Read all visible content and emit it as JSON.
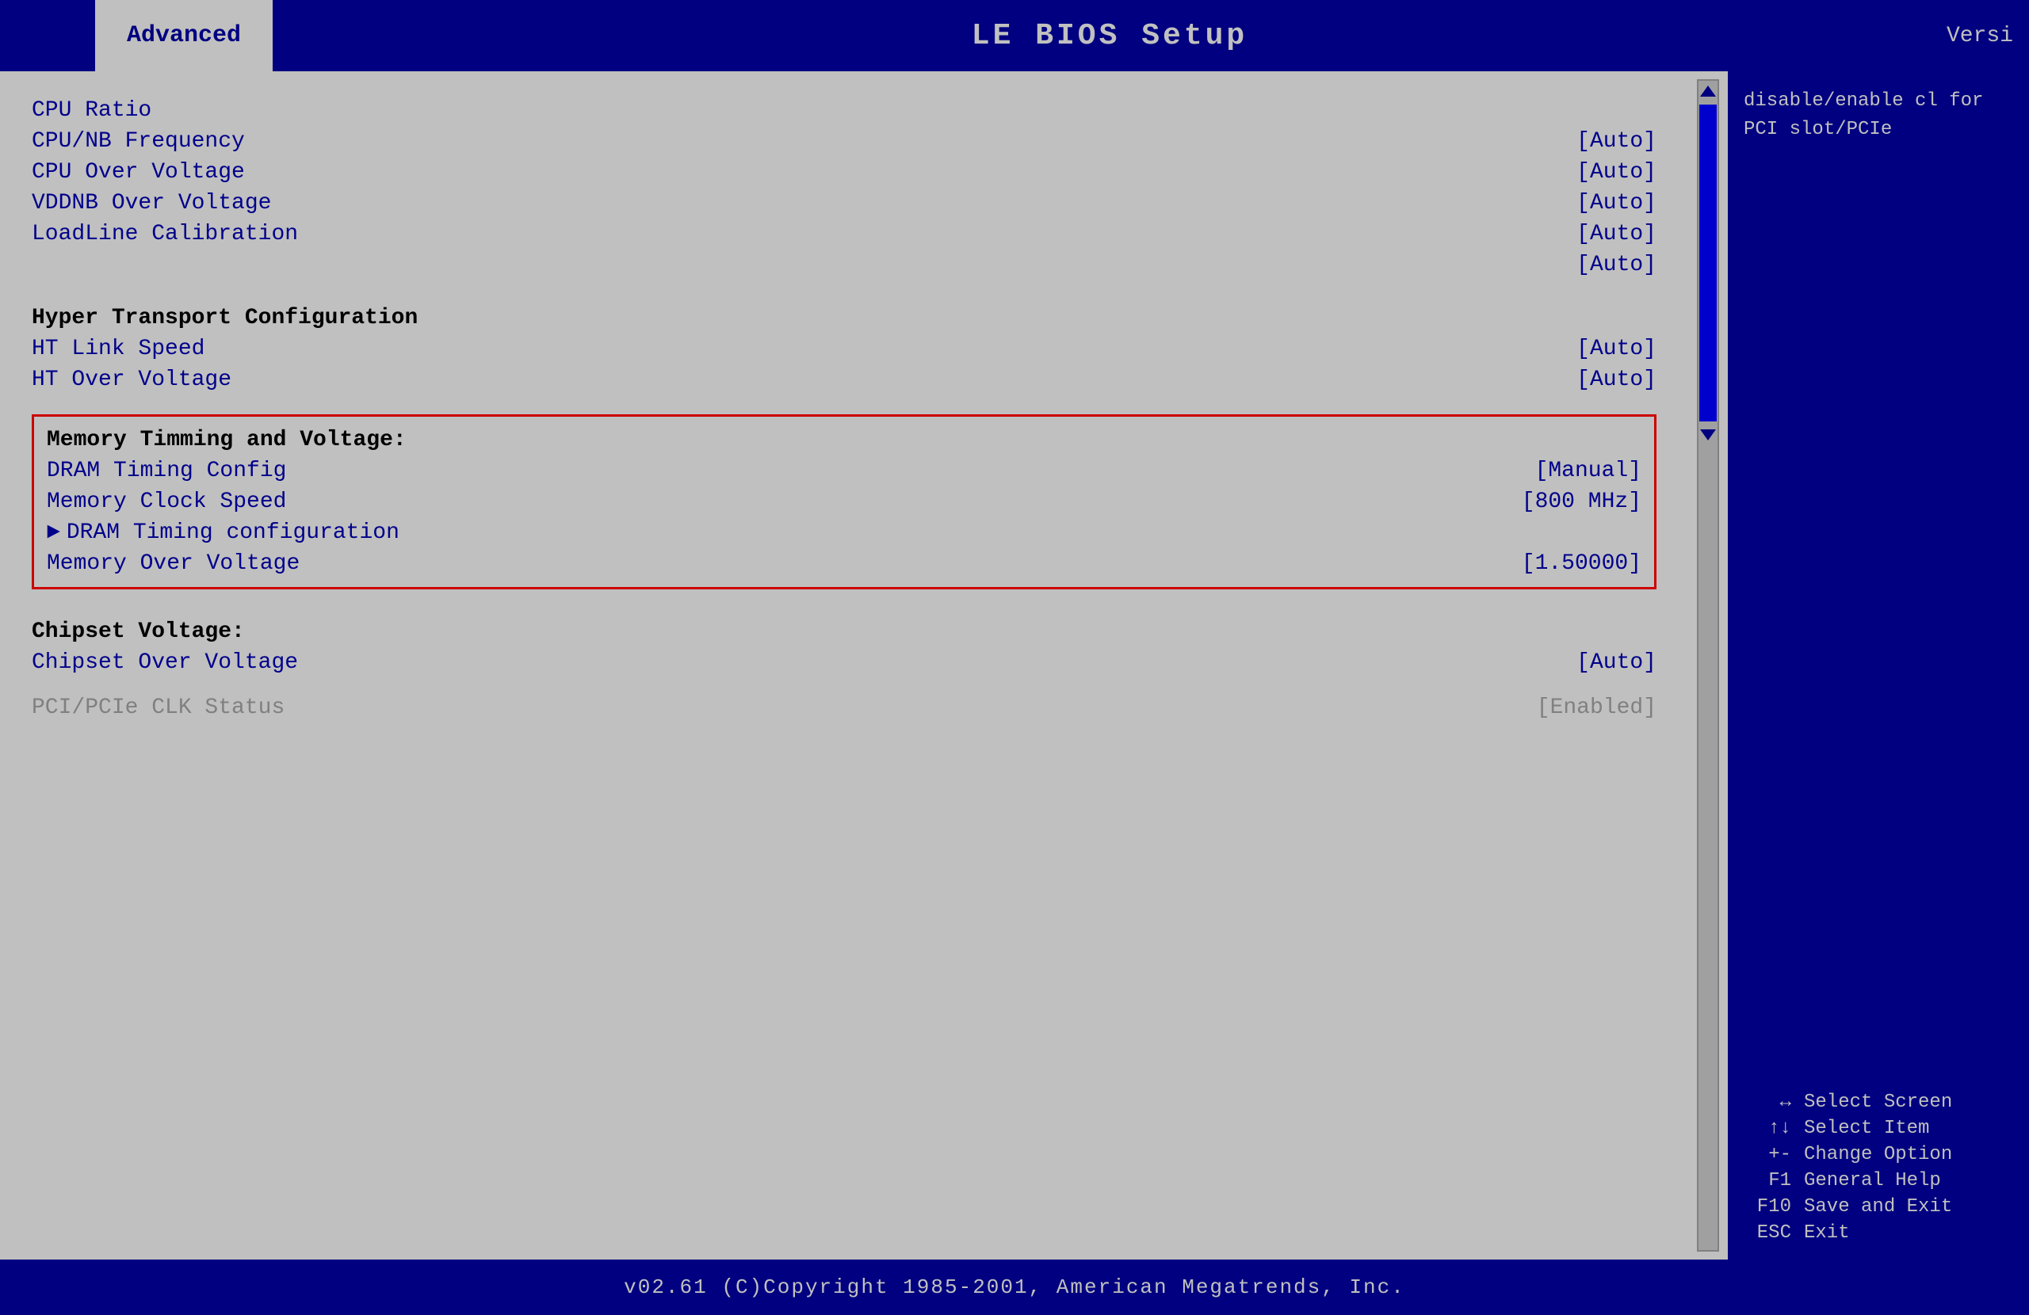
{
  "header": {
    "tab_label": "Advanced",
    "title": "LE BIOS Setup",
    "version_label": "Versi"
  },
  "menu_items": [
    {
      "label": "CPU Ratio",
      "value": "",
      "type": "item"
    },
    {
      "label": "CPU/NB Frequency",
      "value": "[Auto]",
      "type": "item"
    },
    {
      "label": "CPU Over Voltage",
      "value": "[Auto]",
      "type": "item"
    },
    {
      "label": "VDDNB Over Voltage",
      "value": "[Auto]",
      "type": "item"
    },
    {
      "label": "LoadLine Calibration",
      "value": "[Auto]",
      "type": "item"
    },
    {
      "label": "",
      "value": "[Auto]",
      "type": "extra_value"
    },
    {
      "label": "Hyper Transport Configuration",
      "value": "",
      "type": "section"
    },
    {
      "label": "HT Link Speed",
      "value": "",
      "type": "item"
    },
    {
      "label": "HT Over Voltage",
      "value": "[Auto]",
      "type": "item"
    },
    {
      "label": "",
      "value": "[Auto]",
      "type": "extra_value"
    }
  ],
  "highlighted_section": {
    "header": "Memory Timming and Voltage:",
    "items": [
      {
        "label": "DRAM Timing Config",
        "value": "[Manual]"
      },
      {
        "label": "Memory Clock Speed",
        "value": "[800 MHz]"
      },
      {
        "label": "► DRAM Timing configuration",
        "value": ""
      },
      {
        "label": "Memory Over Voltage",
        "value": "[1.50000]"
      }
    ]
  },
  "chipset_section": {
    "header": "Chipset Voltage:",
    "items": [
      {
        "label": "Chipset Over Voltage",
        "value": "[Auto]"
      }
    ]
  },
  "pci_item": {
    "label": "PCI/PCIe CLK Status",
    "value": "[Enabled]"
  },
  "right_panel": {
    "info_text": "disable/enable cl\nfor PCI slot/PCIe",
    "key_help": [
      {
        "key": "↔",
        "desc": "Select Screen"
      },
      {
        "key": "↑↓",
        "desc": "Select Item"
      },
      {
        "key": "+-",
        "desc": "Change Option"
      },
      {
        "key": "F1",
        "desc": "General Help"
      },
      {
        "key": "F10",
        "desc": "Save and Exit"
      },
      {
        "key": "ESC",
        "desc": "Exit"
      }
    ]
  },
  "footer": {
    "text": "v02.61  (C)Copyright 1985-2001, American Megatrends, Inc."
  }
}
